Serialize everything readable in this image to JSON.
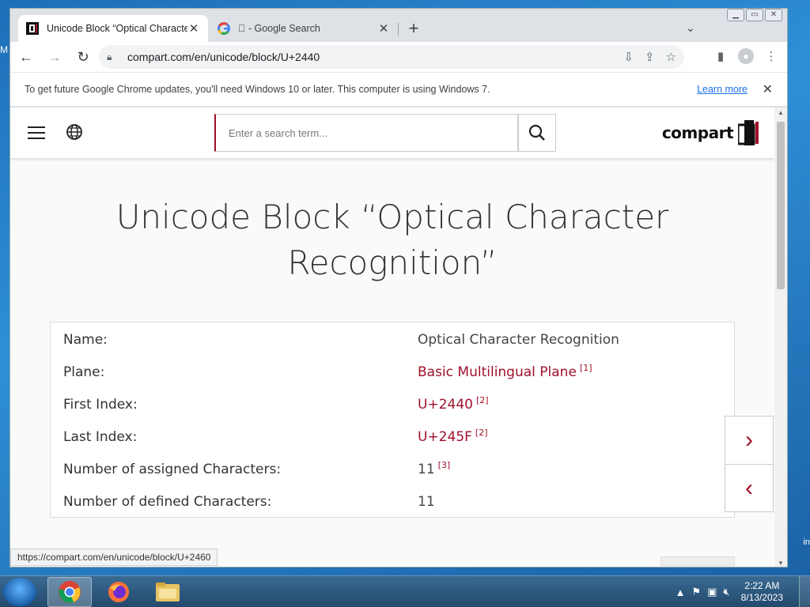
{
  "browser": {
    "tabs": [
      {
        "title": "Unicode Block “Optical Characte",
        "active": true
      },
      {
        "title": "\u0000 - Google Search",
        "active": false
      }
    ],
    "url": "compart.com/en/unicode/block/U+2440",
    "infobar": {
      "message": "To get future Google Chrome updates, you'll need Windows 10 or later. This computer is using Windows 7.",
      "learn_more": "Learn more"
    },
    "status_url": "https://compart.com/en/unicode/block/U+2460"
  },
  "site": {
    "search_placeholder": "Enter a search term...",
    "logo_text": "compart",
    "title": "Unicode Block “Optical Character Recognition”",
    "rows": [
      {
        "key": "Name:",
        "value": "Optical Character Recognition",
        "ref": ""
      },
      {
        "key": "Plane:",
        "value": "Basic Multilingual Plane",
        "ref": "[1]"
      },
      {
        "key": "First Index:",
        "value": "U+2440",
        "ref": "[2]"
      },
      {
        "key": "Last Index:",
        "value": "U+245F",
        "ref": "[2]"
      },
      {
        "key": "Number of assigned Characters:",
        "value": "11",
        "ref": "[3]"
      },
      {
        "key": "Number of defined Characters:",
        "value": "11",
        "ref": ""
      }
    ],
    "next_arrow": "›",
    "prev_arrow": "‹"
  },
  "taskbar": {
    "time": "2:22 AM",
    "date": "8/13/2023"
  },
  "colors": {
    "accent": "#a0102a",
    "chrome_link": "#1a73e8"
  }
}
